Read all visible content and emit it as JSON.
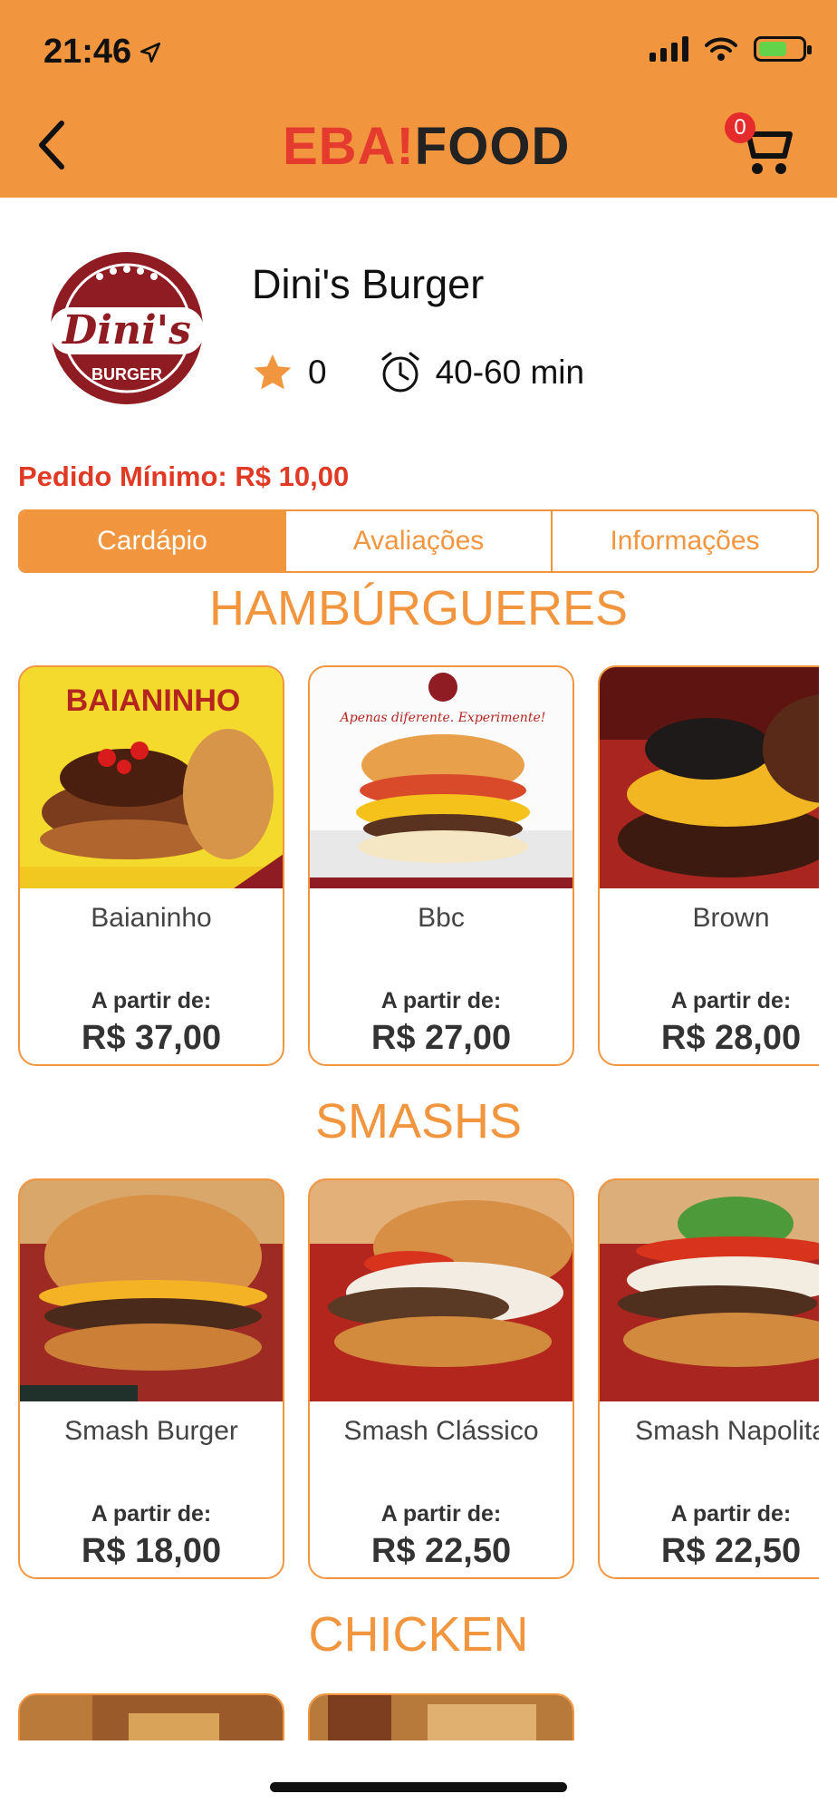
{
  "status": {
    "time": "21:46"
  },
  "header": {
    "brand_left": "EBA!",
    "brand_right": "FOOD",
    "cart_count": "0"
  },
  "store": {
    "name": "Dini's Burger",
    "logo_text": "Dini's",
    "logo_sub": "BURGER",
    "rating": "0",
    "delivery_time": "40-60 min",
    "min_order": "Pedido Mínimo: R$ 10,00"
  },
  "tabs": [
    "Cardápio",
    "Avaliações",
    "Informações"
  ],
  "sections": [
    {
      "title": "HAMBÚRGUERES",
      "items": [
        {
          "name": "Baianinho",
          "from": "A partir de:",
          "price": "R$ 37,00",
          "img_text": "BAIANINHO"
        },
        {
          "name": "Bbc",
          "from": "A partir de:",
          "price": "R$ 27,00",
          "img_text": "Apenas diferente. Experimente!"
        },
        {
          "name": "Brown",
          "from": "A partir de:",
          "price": "R$ 28,00"
        }
      ]
    },
    {
      "title": "SMASHS",
      "items": [
        {
          "name": "Smash Burger",
          "from": "A partir de:",
          "price": "R$ 18,00"
        },
        {
          "name": "Smash Clássico",
          "from": "A partir de:",
          "price": "R$ 22,50"
        },
        {
          "name": "Smash Napolita",
          "from": "A partir de:",
          "price": "R$ 22,50"
        }
      ]
    },
    {
      "title": "CHICKEN",
      "items": []
    }
  ],
  "colors": {
    "primary": "#f2953f",
    "accent_red": "#e03a25",
    "cart_badge": "#e52b2b"
  }
}
